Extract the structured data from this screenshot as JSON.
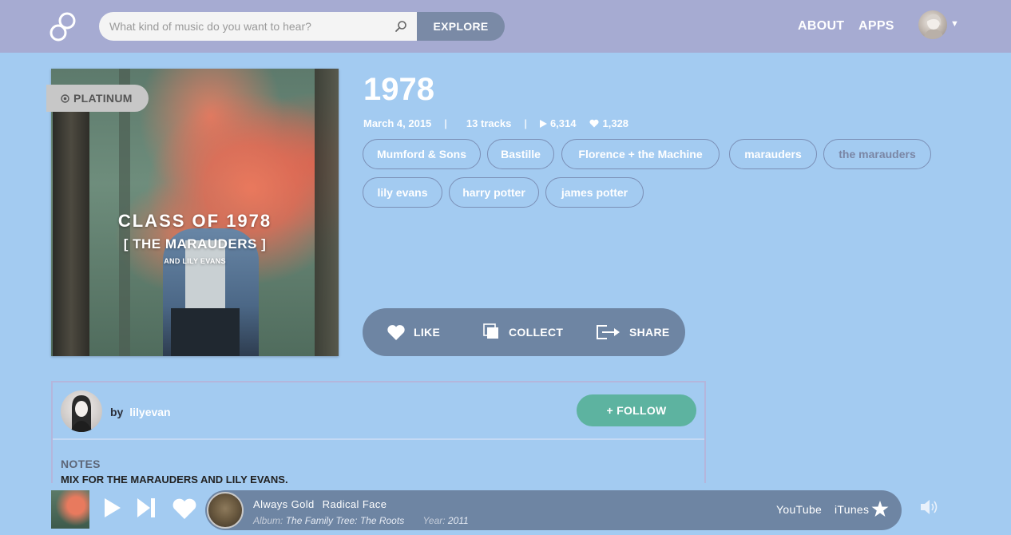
{
  "header": {
    "search_placeholder": "What kind of music do you want to hear?",
    "explore_label": "EXPLORE",
    "nav": [
      "ABOUT",
      "APPS"
    ]
  },
  "cover": {
    "badge": "PLATINUM",
    "line1": "CLASS OF 1978",
    "line2": "[ THE MARAUDERS ]",
    "line3": "AND LILY EVANS"
  },
  "mix": {
    "title": "1978",
    "date": "March 4, 2015",
    "tracks": "13 tracks",
    "plays": "6,314",
    "likes": "1,328",
    "tags": [
      "Mumford & Sons",
      "Bastille",
      "Florence + the Machine",
      "marauders",
      "the marauders",
      "lily evans",
      "harry potter",
      "james potter"
    ]
  },
  "actions": {
    "like": "LIKE",
    "collect": "COLLECT",
    "share": "SHARE"
  },
  "creator": {
    "by": "by",
    "username": "lilyevan",
    "follow": "+ FOLLOW",
    "notes_label": "NOTES",
    "notes_text": "MIX FOR THE MARAUDERS AND LILY EVANS."
  },
  "player": {
    "track": "Always Gold",
    "artist": "Radical Face",
    "album_label": "Album:",
    "album": "The Family Tree: The Roots",
    "year_label": "Year:",
    "year": "2011",
    "youtube": "YouTube",
    "itunes": "iTunes"
  },
  "colors": {
    "page_bg": "#a3cbf1",
    "header_bg": "#a6abd2",
    "panel_bg": "#6e85a3",
    "follow_green": "#5db3a0"
  }
}
